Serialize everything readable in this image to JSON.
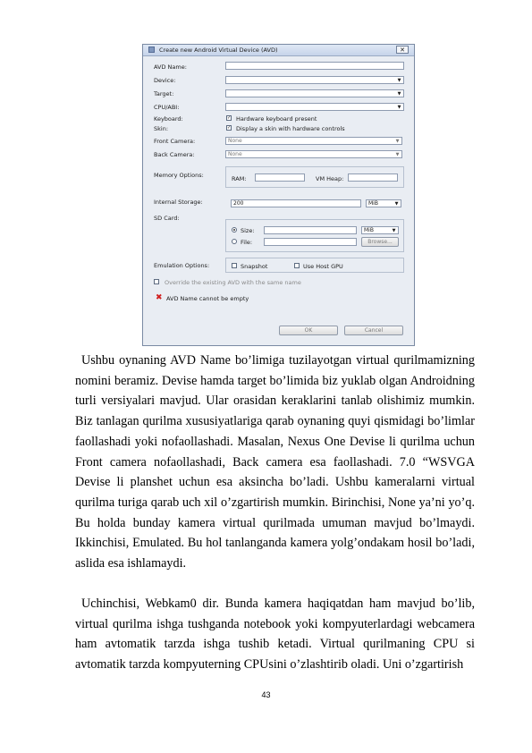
{
  "dialog": {
    "title": "Create new Android Virtual Device (AVD)",
    "close_label": "✕",
    "labels": {
      "avd_name": "AVD Name:",
      "device": "Device:",
      "target": "Target:",
      "cpu_abi": "CPU/ABI:",
      "keyboard": "Keyboard:",
      "skin": "Skin:",
      "front_camera": "Front Camera:",
      "back_camera": "Back Camera:",
      "memory_options": "Memory Options:",
      "internal_storage": "Internal Storage:",
      "sd_card": "SD Card:",
      "emulation_options": "Emulation Options:"
    },
    "keyboard_option": "Hardware keyboard present",
    "skin_option": "Display a skin with hardware controls",
    "front_camera_value": "None",
    "back_camera_value": "None",
    "ram_label": "RAM:",
    "vm_heap_label": "VM Heap:",
    "internal_storage_value": "200",
    "internal_storage_unit": "MiB",
    "sd_size_label": "Size:",
    "sd_size_unit": "MiB",
    "sd_file_label": "File:",
    "browse_label": "Browse...",
    "snapshot_label": "Snapshot",
    "use_host_gpu_label": "Use Host GPU",
    "override_label": "Override the existing AVD with the same name",
    "error_message": "AVD Name cannot be empty",
    "ok_label": "OK",
    "cancel_label": "Cancel"
  },
  "paragraph1": "Ushbu oynaning AVD Name bo’limiga tuzilayotgan virtual qurilmamizning nomini beramiz. Devise hamda target bo’limida biz yuklab olgan Androidning turli versiyalari mavjud. Ular orasidan keraklarini tanlab olishimiz mumkin. Biz tanlagan qurilma xususiyatlariga qarab oynaning quyi qismidagi bo’limlar faollashadi yoki nofaollashadi. Masalan, Nexus One Devise li qurilma uchun Front camera nofaollashadi, Back camera esa faollashadi. 7.0 “WSVGA Devise li planshet uchun esa aksincha bo’ladi. Ushbu kameralarni virtual qurilma turiga qarab uch xil o’zgartirish mumkin. Birinchisi, None ya’ni yo’q. Bu holda bunday kamera virtual qurilmada umuman mavjud bo’lmaydi. Ikkinchisi, Emulated. Bu hol tanlanganda kamera yolg’ondakam hosil bo’ladi, aslida esa ishlamaydi.",
  "paragraph2": "Uchinchisi, Webkam0 dir. Bunda kamera haqiqatdan ham mavjud bo’lib, virtual qurilma ishga tushganda notebook yoki kompyuterlardagi webcamera ham avtomatik tarzda ishga tushib ketadi. Virtual qurilmaning CPU si avtomatik tarzda kompyuterning CPUsini o’zlashtirib oladi. Uni o’zgartirish",
  "page_number": "43"
}
